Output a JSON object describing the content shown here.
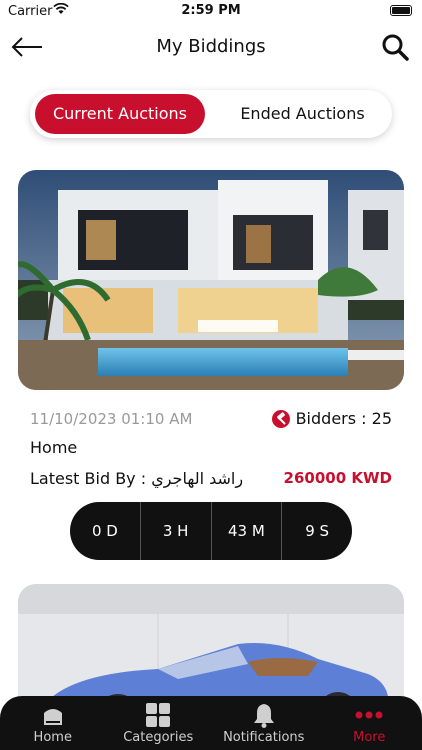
{
  "status_bar": {
    "carrier": "Carrier",
    "time": "2:59 PM"
  },
  "header": {
    "title": "My Biddings",
    "back_icon": "arrow-left-icon",
    "search_icon": "search-icon"
  },
  "tabs": [
    {
      "label": "Current Auctions",
      "active": true
    },
    {
      "label": "Ended Auctions",
      "active": false
    }
  ],
  "auctions": [
    {
      "date": "11/10/2023 01:10 AM",
      "bidders": "Bidders : 25",
      "category": "Home",
      "latest_bid_label": "Latest Bid By : راشد الهاجري",
      "amount": "260000 KWD",
      "countdown": [
        "0 D",
        "3 H",
        "43 M",
        "9 S"
      ]
    }
  ],
  "bottom_nav": [
    {
      "label": "Home",
      "icon": "home-icon"
    },
    {
      "label": "Categories",
      "icon": "grid-icon"
    },
    {
      "label": "Notifications",
      "icon": "bell-icon"
    },
    {
      "label": "More",
      "icon": "more-dots-icon",
      "active": true
    }
  ],
  "colors": {
    "accent": "#c8102e",
    "dark": "#111111"
  }
}
